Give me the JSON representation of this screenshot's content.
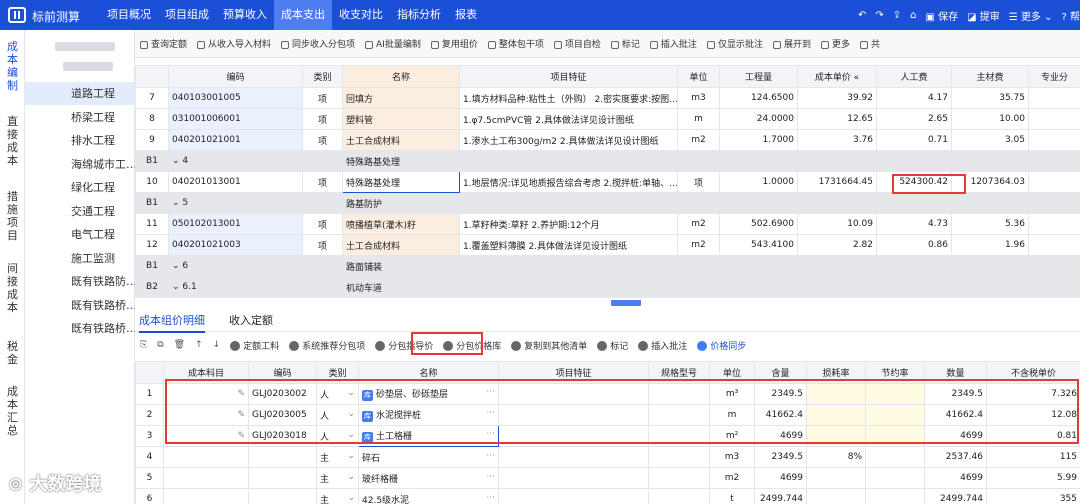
{
  "app": {
    "title": "标前测算"
  },
  "nav": [
    "项目概况",
    "项目组成",
    "预算收入",
    "成本支出",
    "收支对比",
    "指标分析",
    "报表"
  ],
  "nav_active": 3,
  "topright": {
    "save": "保存",
    "submit": "提审",
    "more": "更多",
    "help": "帮"
  },
  "leftnav": [
    "成本编制",
    "直接成本",
    "措施项目",
    "间接成本",
    "税金",
    "成本汇总"
  ],
  "subnav": [
    "道路工程",
    "桥梁工程",
    "排水工程",
    "海绵城市工…",
    "绿化工程",
    "交通工程",
    "电气工程",
    "施工监测",
    "既有铁路防…",
    "既有铁路桥…",
    "既有铁路桥…"
  ],
  "toolbar": [
    "查询定额",
    "从收入导入材料",
    "同步收入分包项",
    "AI批量编制",
    "复用组价",
    "整体包干项",
    "项目自检",
    "标记",
    "插入批注",
    "仅显示批注",
    "展开到",
    "更多",
    "共"
  ],
  "grid1": {
    "headers": [
      "",
      "编码",
      "类别",
      "名称",
      "项目特征",
      "单位",
      "工程量",
      "成本单价 «",
      "人工费",
      "主材费",
      "专业分"
    ],
    "rows": [
      {
        "no": "7",
        "code": "040103001005",
        "type": "项",
        "name": "回填方",
        "feature": "1.填方材料品种:粘性土（外购） 2.密实度要求:按图…",
        "unit": "m3",
        "qty": "124.6500",
        "price": "39.92",
        "labor": "4.17",
        "main": "35.75",
        "kind": "row"
      },
      {
        "no": "8",
        "code": "031001006001",
        "type": "项",
        "name": "塑料管",
        "feature": "1.φ7.5cmPVC管 2.具体做法详见设计图纸",
        "unit": "m",
        "qty": "24.0000",
        "price": "12.65",
        "labor": "2.65",
        "main": "10.00",
        "kind": "row"
      },
      {
        "no": "9",
        "code": "040201021001",
        "type": "项",
        "name": "土工合成材料",
        "feature": "1.渗水土工布300g/m2 2.具体做法详见设计图纸",
        "unit": "m2",
        "qty": "1.7000",
        "price": "3.76",
        "labor": "0.71",
        "main": "3.05",
        "kind": "row"
      },
      {
        "no": "B1",
        "code": "⌄ 4",
        "type": "",
        "name": "特殊路基处理",
        "feature": "",
        "unit": "",
        "qty": "",
        "price": "",
        "labor": "",
        "main": "",
        "kind": "grp"
      },
      {
        "no": "10",
        "code": "040201013001",
        "type": "项",
        "name": "特殊路基处理",
        "feature": "1.地层情况:详见地质报告综合考虑 2.搅拌桩:单轴、…",
        "unit": "项",
        "qty": "1.0000",
        "price": "1731664.45",
        "labor": "524300.42",
        "main": "1207364.03",
        "kind": "sel"
      },
      {
        "no": "B1",
        "code": "⌄ 5",
        "type": "",
        "name": "路基防护",
        "feature": "",
        "unit": "",
        "qty": "",
        "price": "",
        "labor": "",
        "main": "",
        "kind": "grp"
      },
      {
        "no": "11",
        "code": "050102013001",
        "type": "项",
        "name": "喷播植草(灌木)籽",
        "feature": "1.草籽种类:草籽 2.养护期:12个月",
        "unit": "m2",
        "qty": "502.6900",
        "price": "10.09",
        "labor": "4.73",
        "main": "5.36",
        "kind": "row"
      },
      {
        "no": "12",
        "code": "040201021003",
        "type": "项",
        "name": "土工合成材料",
        "feature": "1.覆盖塑料薄膜 2.具体做法详见设计图纸",
        "unit": "m2",
        "qty": "543.4100",
        "price": "2.82",
        "labor": "0.86",
        "main": "1.96",
        "kind": "row"
      },
      {
        "no": "B1",
        "code": "⌄ 6",
        "type": "",
        "name": "路面铺装",
        "feature": "",
        "unit": "",
        "qty": "",
        "price": "",
        "labor": "",
        "main": "",
        "kind": "grp"
      },
      {
        "no": "B2",
        "code": "⌄ 6.1",
        "type": "",
        "name": "机动车道",
        "feature": "",
        "unit": "",
        "qty": "",
        "price": "",
        "labor": "",
        "main": "",
        "kind": "grp"
      }
    ]
  },
  "tabs2": [
    "成本组价明细",
    "收入定额"
  ],
  "toolbar2": [
    "定额工料",
    "系统推荐分包项",
    "分包指导价",
    "分包价格库",
    "复制到其他清单",
    "标记",
    "插入批注",
    "价格同步"
  ],
  "grid2": {
    "headers": [
      "",
      "成本科目",
      "编码",
      "类别",
      "名称",
      "项目特征",
      "规格型号",
      "单位",
      "含量",
      "损耗率",
      "节约率",
      "数量",
      "不含税单价"
    ],
    "rows": [
      {
        "no": "1",
        "code": "GLJ0203002",
        "type": "人",
        "name": "砂垫层、砂砾垫层",
        "chip": "库",
        "unit": "m³",
        "content": "2349.5",
        "loss": "",
        "save": "",
        "qty": "2349.5",
        "price": "7.326"
      },
      {
        "no": "2",
        "code": "GLJ0203005",
        "type": "人",
        "name": "水泥搅拌桩",
        "chip": "库",
        "unit": "m",
        "content": "41662.4",
        "loss": "",
        "save": "",
        "qty": "41662.4",
        "price": "12.08"
      },
      {
        "no": "3",
        "code": "GLJ0203018",
        "type": "人",
        "name": "土工格栅",
        "chip": "库",
        "unit": "m²",
        "content": "4699",
        "loss": "",
        "save": "",
        "qty": "4699",
        "price": "0.81"
      },
      {
        "no": "4",
        "code": "",
        "type": "主",
        "name": "碎石",
        "chip": "",
        "unit": "m3",
        "content": "2349.5",
        "loss": "8%",
        "save": "",
        "qty": "2537.46",
        "price": "115"
      },
      {
        "no": "5",
        "code": "",
        "type": "主",
        "name": "玻纤格栅",
        "chip": "",
        "unit": "m2",
        "content": "4699",
        "loss": "",
        "save": "",
        "qty": "4699",
        "price": "5.99"
      },
      {
        "no": "6",
        "code": "",
        "type": "主",
        "name": "42.5级水泥",
        "chip": "",
        "unit": "t",
        "content": "2499.744",
        "loss": "",
        "save": "",
        "qty": "2499.744",
        "price": "355"
      }
    ]
  },
  "watermark": "大数跨境",
  "colors": {
    "brand": "#1b4fd6",
    "highlight": "#e53935"
  }
}
